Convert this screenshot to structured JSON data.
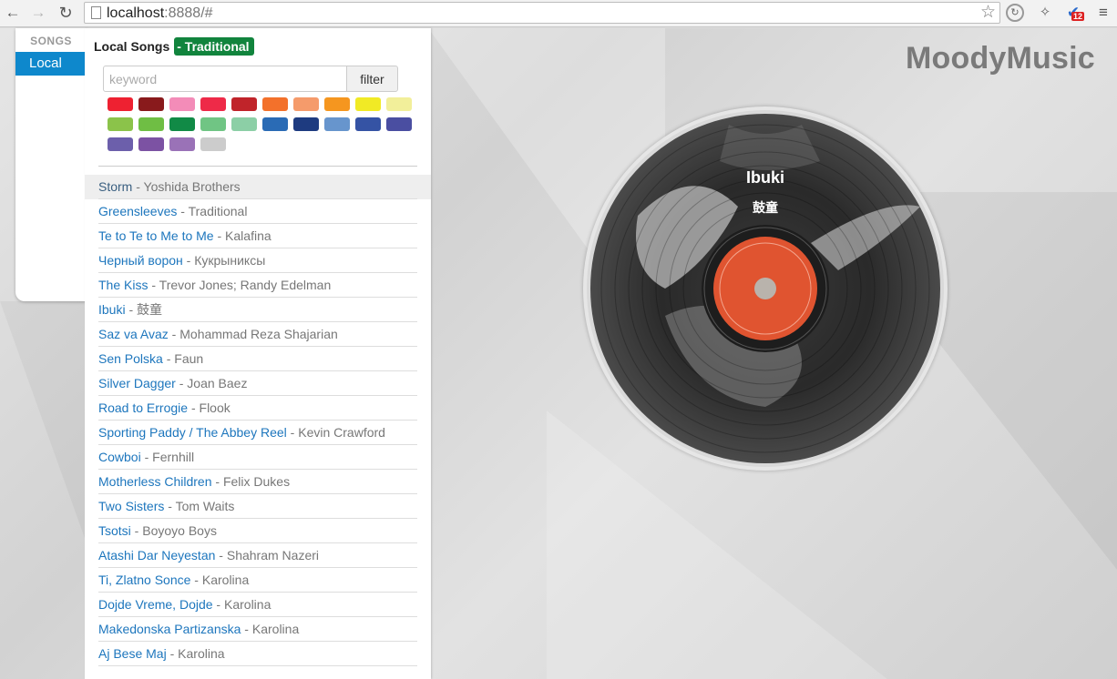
{
  "browser": {
    "url_host": "localhost",
    "url_rest": ":8888/#",
    "extension_badge": "12",
    "icons": [
      "back-arrow-icon",
      "forward-arrow-icon",
      "reload-icon",
      "page-icon",
      "star-icon",
      "refresh-extension-icon",
      "extension-icon",
      "checkmark-extension-icon",
      "menu-icon"
    ]
  },
  "sidebar": {
    "header": "SONGS",
    "items": [
      {
        "label": "Local"
      }
    ]
  },
  "panel": {
    "title": "Local Songs",
    "tag": "- Traditional",
    "search_placeholder": "keyword",
    "filter_label": "filter"
  },
  "swatches": [
    "#ee2131",
    "#891a1c",
    "#f38cb8",
    "#ee2a48",
    "#c0242a",
    "#f3712b",
    "#f59b6b",
    "#f5961f",
    "#f1ea25",
    "#f2ef9a",
    "#8bc34a",
    "#6fbe44",
    "#118a46",
    "#70c584",
    "#8ccfa6",
    "#2a6bb5",
    "#1e3b80",
    "#6795cd",
    "#3553a4",
    "#4a4ea1",
    "#6c5fab",
    "#7c52a3",
    "#9a72b7",
    "#cccccc"
  ],
  "songs": [
    {
      "title": "Storm",
      "artist": "Yoshida Brothers"
    },
    {
      "title": "Greensleeves",
      "artist": "Traditional"
    },
    {
      "title": "Te to Te to Me to Me",
      "artist": "Kalafina"
    },
    {
      "title": "Черный ворон",
      "artist": "Кукрыниксы"
    },
    {
      "title": "The Kiss",
      "artist": "Trevor Jones; Randy Edelman"
    },
    {
      "title": "Ibuki",
      "artist": "鼓童"
    },
    {
      "title": "Saz va Avaz",
      "artist": "Mohammad Reza Shajarian"
    },
    {
      "title": "Sen Polska",
      "artist": "Faun"
    },
    {
      "title": "Silver Dagger",
      "artist": "Joan Baez"
    },
    {
      "title": "Road to Errogie",
      "artist": "Flook"
    },
    {
      "title": "Sporting Paddy / The Abbey Reel",
      "artist": "Kevin Crawford"
    },
    {
      "title": "Cowboi",
      "artist": "Fernhill"
    },
    {
      "title": "Motherless Children",
      "artist": "Felix Dukes"
    },
    {
      "title": "Two Sisters",
      "artist": "Tom Waits"
    },
    {
      "title": "Tsotsi",
      "artist": "Boyoyo Boys"
    },
    {
      "title": "Atashi Dar Neyestan",
      "artist": "Shahram Nazeri"
    },
    {
      "title": "Ti, Zlatno Sonce",
      "artist": "Karolina"
    },
    {
      "title": "Dojde Vreme, Dojde",
      "artist": "Karolina"
    },
    {
      "title": "Makedonska Partizanska",
      "artist": "Karolina"
    },
    {
      "title": "Aj Bese Maj",
      "artist": "Karolina"
    }
  ],
  "active_song_index": 0,
  "now_playing": {
    "title": "Ibuki",
    "artist": "鼓童"
  },
  "brand": "MoodyMusic",
  "colors": {
    "accent": "#0e88cc",
    "tag": "#11843d",
    "link": "#1d76bd",
    "label": "#e05430"
  }
}
